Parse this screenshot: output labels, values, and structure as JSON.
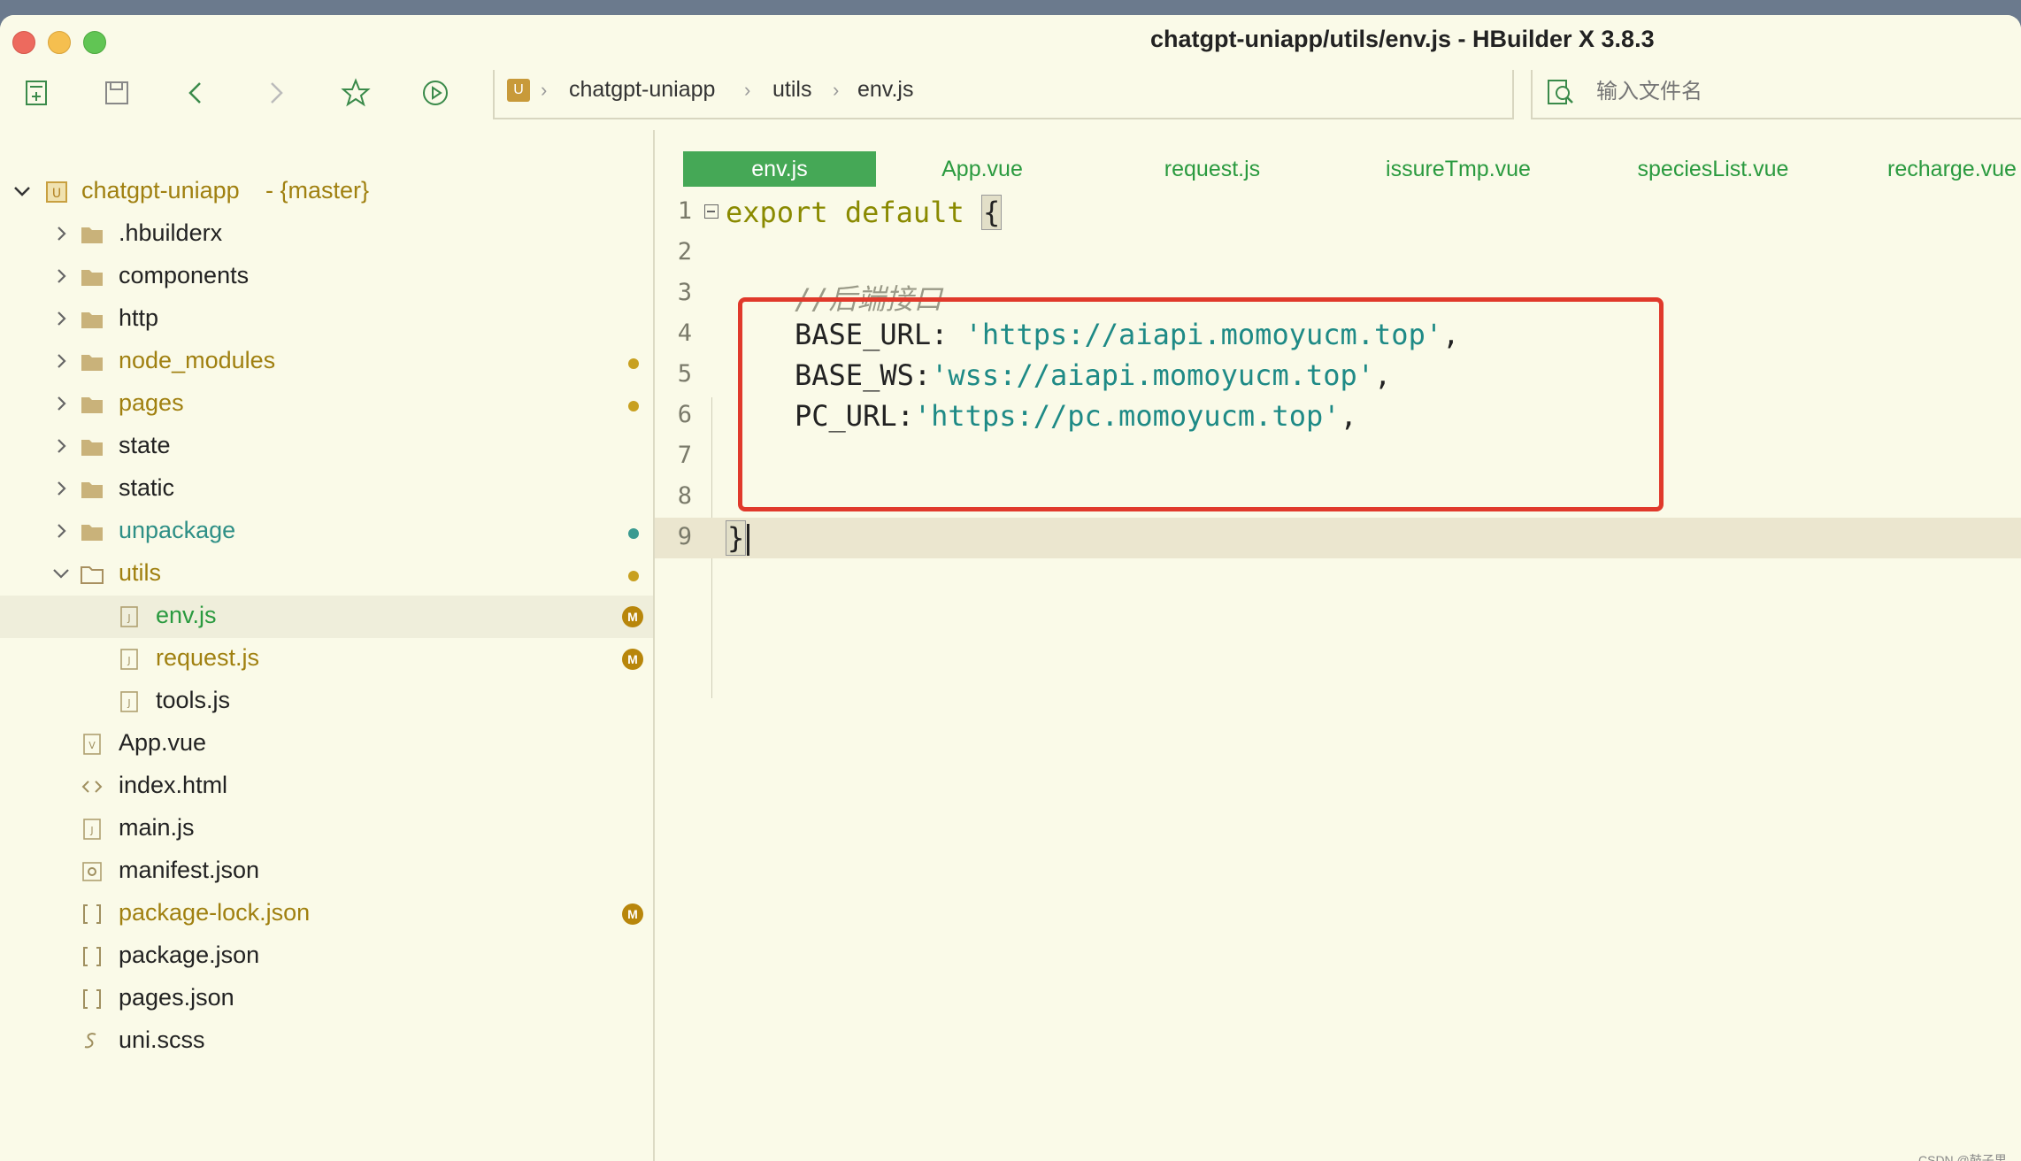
{
  "window": {
    "title": "chatgpt-uniapp/utils/env.js - HBuilder X 3.8.3"
  },
  "toolbar": {
    "icons": [
      "new-file-icon",
      "save-icon",
      "back-icon",
      "forward-icon",
      "favorite-star-icon",
      "run-icon"
    ]
  },
  "breadcrumb": {
    "items": [
      "chatgpt-uniapp",
      "utils",
      "env.js"
    ]
  },
  "search": {
    "placeholder": "输入文件名"
  },
  "sidebar": {
    "project": "chatgpt-uniapp",
    "branch": "- {master}",
    "items": [
      {
        "label": ".hbuilderx",
        "type": "folder",
        "color": "default"
      },
      {
        "label": "components",
        "type": "folder",
        "color": "default"
      },
      {
        "label": "http",
        "type": "folder",
        "color": "default"
      },
      {
        "label": "node_modules",
        "type": "folder",
        "color": "gold",
        "dot": "#c8a020"
      },
      {
        "label": "pages",
        "type": "folder",
        "color": "gold",
        "dot": "#c8a020"
      },
      {
        "label": "state",
        "type": "folder",
        "color": "default"
      },
      {
        "label": "static",
        "type": "folder",
        "color": "default"
      },
      {
        "label": "unpackage",
        "type": "folder",
        "color": "teal",
        "dot": "#3a9a90"
      },
      {
        "label": "utils",
        "type": "folder-open",
        "color": "gold",
        "dot": "#c8a020"
      },
      {
        "label": "env.js",
        "type": "js",
        "color": "green",
        "badge": "M"
      },
      {
        "label": "request.js",
        "type": "js",
        "color": "gold",
        "badge": "M"
      },
      {
        "label": "tools.js",
        "type": "js",
        "color": "default"
      },
      {
        "label": "App.vue",
        "type": "vue",
        "color": "default"
      },
      {
        "label": "index.html",
        "type": "html",
        "color": "default"
      },
      {
        "label": "main.js",
        "type": "js",
        "color": "default"
      },
      {
        "label": "manifest.json",
        "type": "manifest",
        "color": "default"
      },
      {
        "label": "package-lock.json",
        "type": "json",
        "color": "gold",
        "badge": "M"
      },
      {
        "label": "package.json",
        "type": "json",
        "color": "default"
      },
      {
        "label": "pages.json",
        "type": "json",
        "color": "default"
      },
      {
        "label": "uni.scss",
        "type": "scss",
        "color": "default"
      }
    ]
  },
  "tabs": [
    "env.js",
    "App.vue",
    "request.js",
    "issureTmp.vue",
    "speciesList.vue",
    "recharge.vue"
  ],
  "editor": {
    "line_numbers": [
      "1",
      "2",
      "3",
      "4",
      "5",
      "6",
      "7",
      "8",
      "9"
    ],
    "code": {
      "kw_export": "export",
      "kw_default": "default",
      "open_brace": "{",
      "comment": "//后端接口",
      "key1": "BASE_URL: ",
      "val1": "'https://aiapi.momoyucm.top'",
      "key2": "BASE_WS:",
      "val2": "'wss://aiapi.momoyucm.top'",
      "key3": "PC_URL:",
      "val3": "'https://pc.momoyucm.top'",
      "comma": ",",
      "close_brace": "}"
    }
  },
  "watermark": "CSDN @鼓子里",
  "colors": {
    "accent_green": "#45a856",
    "highlight_red": "#e0392b",
    "string_teal": "#1e8a86",
    "keyword_olive": "#8a8a00"
  }
}
